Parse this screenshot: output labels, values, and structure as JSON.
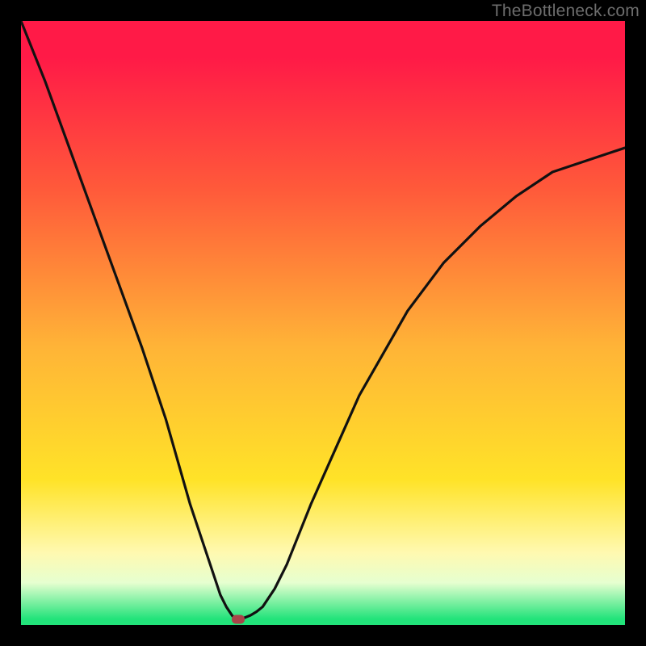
{
  "watermark": {
    "text": "TheBottleneck.com"
  },
  "colors": {
    "gradient_top": "#ff1a47",
    "gradient_mid1": "#ff5a3a",
    "gradient_mid2": "#ffb437",
    "gradient_mid3": "#ffe328",
    "gradient_mid4": "#fff9b0",
    "gradient_mid5": "#e6ffd0",
    "gradient_bottom": "#22e37a",
    "frame": "#000000",
    "curve": "#111111",
    "dot": "#a94449",
    "watermark": "#6d6d6d"
  },
  "chart_data": {
    "type": "line",
    "title": "",
    "xlabel": "",
    "ylabel": "",
    "xlim": [
      0,
      100
    ],
    "ylim": [
      0,
      100
    ],
    "grid": false,
    "legend": false,
    "notes": "V-shaped bottleneck curve over a vertical red→green gradient. Values are in percent (0–100) read off the normalized plot area; x from left, y from bottom. Minimum near x≈36, y≈1.",
    "series": [
      {
        "name": "bottleneck-curve",
        "x": [
          0,
          4,
          8,
          12,
          16,
          20,
          24,
          28,
          30,
          32,
          33,
          34,
          35,
          36,
          37,
          38,
          39,
          40,
          42,
          44,
          48,
          52,
          56,
          60,
          64,
          70,
          76,
          82,
          88,
          94,
          100
        ],
        "y": [
          100,
          90,
          79,
          68,
          57,
          46,
          34,
          20,
          14,
          8,
          5,
          3,
          1.5,
          1,
          1.2,
          1.6,
          2.2,
          3,
          6,
          10,
          20,
          29,
          38,
          45,
          52,
          60,
          66,
          71,
          75,
          77,
          79
        ]
      }
    ],
    "marker": {
      "x": 36,
      "y": 1
    }
  }
}
